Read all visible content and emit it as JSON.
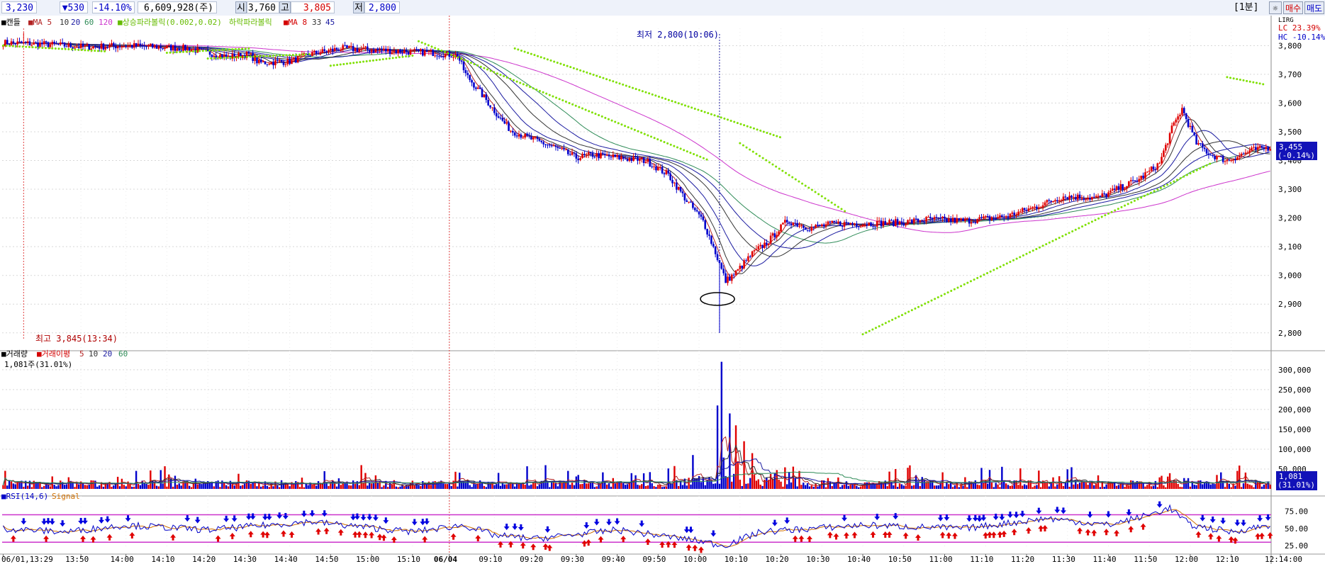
{
  "header": {
    "price": "3,230",
    "change": "▼530",
    "change_pct": "-14.10%",
    "volume": "6,609,928(주)",
    "open_label": "시",
    "open": "3,760",
    "high_label": "고",
    "high": "3,805",
    "low_label": "저",
    "low": "2,800",
    "interval": "[1분]",
    "buy_label": "매수",
    "sell_label": "매도"
  },
  "colors": {
    "up": "#e00000",
    "down": "#0000cc",
    "parabolic": "#7fe000",
    "ma120": "#cc33cc",
    "ma60": "#2e8b57",
    "ma20": "#1a1aa0",
    "ma10": "#333333",
    "ma5": "#b22222"
  },
  "chart_data": [
    {
      "type": "candlestick",
      "title": "",
      "legend": [
        "■캔들",
        "■MA 5",
        "10",
        "20",
        "60",
        "120",
        "■상승파라볼릭(0.002,0.02)",
        "하락파라볼릭",
        "■MA 8",
        "33",
        "45"
      ],
      "legend_placement": "top-left",
      "right_tag": "LIRG",
      "lc_text": "LC  23.39%",
      "hc_text": "HC -10.14%",
      "current_price_tag": "3,455",
      "current_pct_tag": "(-0.14%)",
      "high_annotation": "최고 3,845(13:34)",
      "low_annotation": "최저 2,800(10:06)",
      "ylim": [
        2760,
        3860
      ],
      "y_ticks": [
        "3,800",
        "3,700",
        "3,600",
        "3,500",
        "3,400",
        "3,300",
        "3,200",
        "3,100",
        "3,000",
        "2,900",
        "2,800"
      ],
      "x_ticks": [
        "06/01,13:29",
        "13:50",
        "14:00",
        "14:10",
        "14:20",
        "14:30",
        "14:40",
        "14:50",
        "15:00",
        "15:10",
        "06/04",
        "09:10",
        "09:20",
        "09:30",
        "09:40",
        "09:50",
        "10:00",
        "10:10",
        "10:20",
        "10:30",
        "10:40",
        "10:50",
        "11:00",
        "11:10",
        "11:20",
        "11:30",
        "11:40",
        "11:50",
        "12:00",
        "12:10",
        "12:14:00"
      ],
      "close_anchors": [
        [
          0,
          3810
        ],
        [
          20,
          3805
        ],
        [
          40,
          3795
        ],
        [
          60,
          3800
        ],
        [
          75,
          3795
        ],
        [
          90,
          3790
        ],
        [
          110,
          3760
        ],
        [
          120,
          3770
        ],
        [
          125,
          3740
        ],
        [
          140,
          3745
        ],
        [
          150,
          3770
        ],
        [
          165,
          3790
        ],
        [
          180,
          3785
        ],
        [
          195,
          3780
        ],
        [
          210,
          3775
        ],
        [
          222,
          3765
        ],
        [
          226,
          3700
        ],
        [
          235,
          3620
        ],
        [
          243,
          3545
        ],
        [
          248,
          3505
        ],
        [
          256,
          3480
        ],
        [
          268,
          3450
        ],
        [
          280,
          3410
        ],
        [
          288,
          3420
        ],
        [
          300,
          3410
        ],
        [
          314,
          3400
        ],
        [
          325,
          3350
        ],
        [
          334,
          3260
        ],
        [
          342,
          3190
        ],
        [
          348,
          3080
        ],
        [
          353,
          2980
        ],
        [
          358,
          3010
        ],
        [
          366,
          3075
        ],
        [
          374,
          3120
        ],
        [
          383,
          3190
        ],
        [
          394,
          3165
        ],
        [
          406,
          3180
        ],
        [
          420,
          3180
        ],
        [
          440,
          3185
        ],
        [
          452,
          3195
        ],
        [
          470,
          3190
        ],
        [
          490,
          3205
        ],
        [
          505,
          3240
        ],
        [
          518,
          3275
        ],
        [
          535,
          3270
        ],
        [
          555,
          3335
        ],
        [
          565,
          3390
        ],
        [
          571,
          3510
        ],
        [
          576,
          3580
        ],
        [
          583,
          3460
        ],
        [
          590,
          3420
        ],
        [
          598,
          3400
        ],
        [
          610,
          3435
        ],
        [
          618,
          3445
        ]
      ]
    },
    {
      "type": "bar",
      "title": "",
      "legend": [
        "■거래량",
        "■거래이평",
        "5",
        "10",
        "20",
        "60"
      ],
      "legend_placement": "top-left",
      "sub_label": "1,081주(31.01%)",
      "current_tag": "1,081",
      "current_pct_tag": "(31.01%)",
      "ylim": [
        0,
        330000
      ],
      "y_ticks": [
        "300,000",
        "250,000",
        "200,000",
        "150,000",
        "100,000",
        "50,000"
      ],
      "spike_volumes": [
        [
          349,
          210000
        ],
        [
          351,
          320000
        ],
        [
          355,
          190000
        ],
        [
          358,
          160000
        ],
        [
          362,
          120000
        ],
        [
          366,
          90000
        ]
      ]
    },
    {
      "type": "line",
      "title": "",
      "legend": [
        "■RSI(14,6)",
        "Signal"
      ],
      "legend_placement": "top-left",
      "ylim": [
        20,
        85
      ],
      "y_ticks": [
        "75.00",
        "50.00",
        "25.00"
      ],
      "overbought": 70,
      "oversold": 30,
      "rsi_anchors": [
        [
          0,
          50
        ],
        [
          30,
          45
        ],
        [
          60,
          55
        ],
        [
          100,
          48
        ],
        [
          150,
          60
        ],
        [
          200,
          45
        ],
        [
          225,
          55
        ],
        [
          240,
          40
        ],
        [
          260,
          35
        ],
        [
          300,
          48
        ],
        [
          340,
          32
        ],
        [
          352,
          25
        ],
        [
          370,
          45
        ],
        [
          420,
          55
        ],
        [
          470,
          50
        ],
        [
          510,
          65
        ],
        [
          540,
          55
        ],
        [
          560,
          70
        ],
        [
          570,
          80
        ],
        [
          580,
          55
        ],
        [
          600,
          45
        ],
        [
          618,
          55
        ]
      ]
    }
  ]
}
